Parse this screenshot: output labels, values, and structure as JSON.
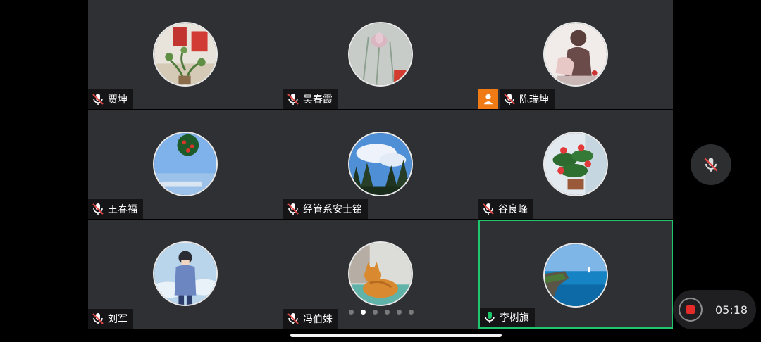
{
  "participants": [
    {
      "name": "贾坤",
      "mic": "muted"
    },
    {
      "name": "吴春霞",
      "mic": "muted"
    },
    {
      "name": "陈瑞坤",
      "mic": "muted",
      "host": true
    },
    {
      "name": "王春福",
      "mic": "muted"
    },
    {
      "name": "经管系安士铭",
      "mic": "muted"
    },
    {
      "name": "谷良峰",
      "mic": "muted"
    },
    {
      "name": "刘军",
      "mic": "muted"
    },
    {
      "name": "冯伯姝",
      "mic": "muted"
    },
    {
      "name": "李树旗",
      "mic": "active",
      "speaking": true
    }
  ],
  "pager": {
    "total": 6,
    "current": 2
  },
  "recording": {
    "time": "05:18"
  },
  "colors": {
    "tile_bg": "#2f3033",
    "active_border": "#1fc66b",
    "muted_mic": "#e04848",
    "host_badge": "#f07a13",
    "record_red": "#e52a2a"
  },
  "icons": {
    "side_control": "mic-off-icon",
    "record": "stop-record-icon",
    "host": "host-person-icon"
  }
}
